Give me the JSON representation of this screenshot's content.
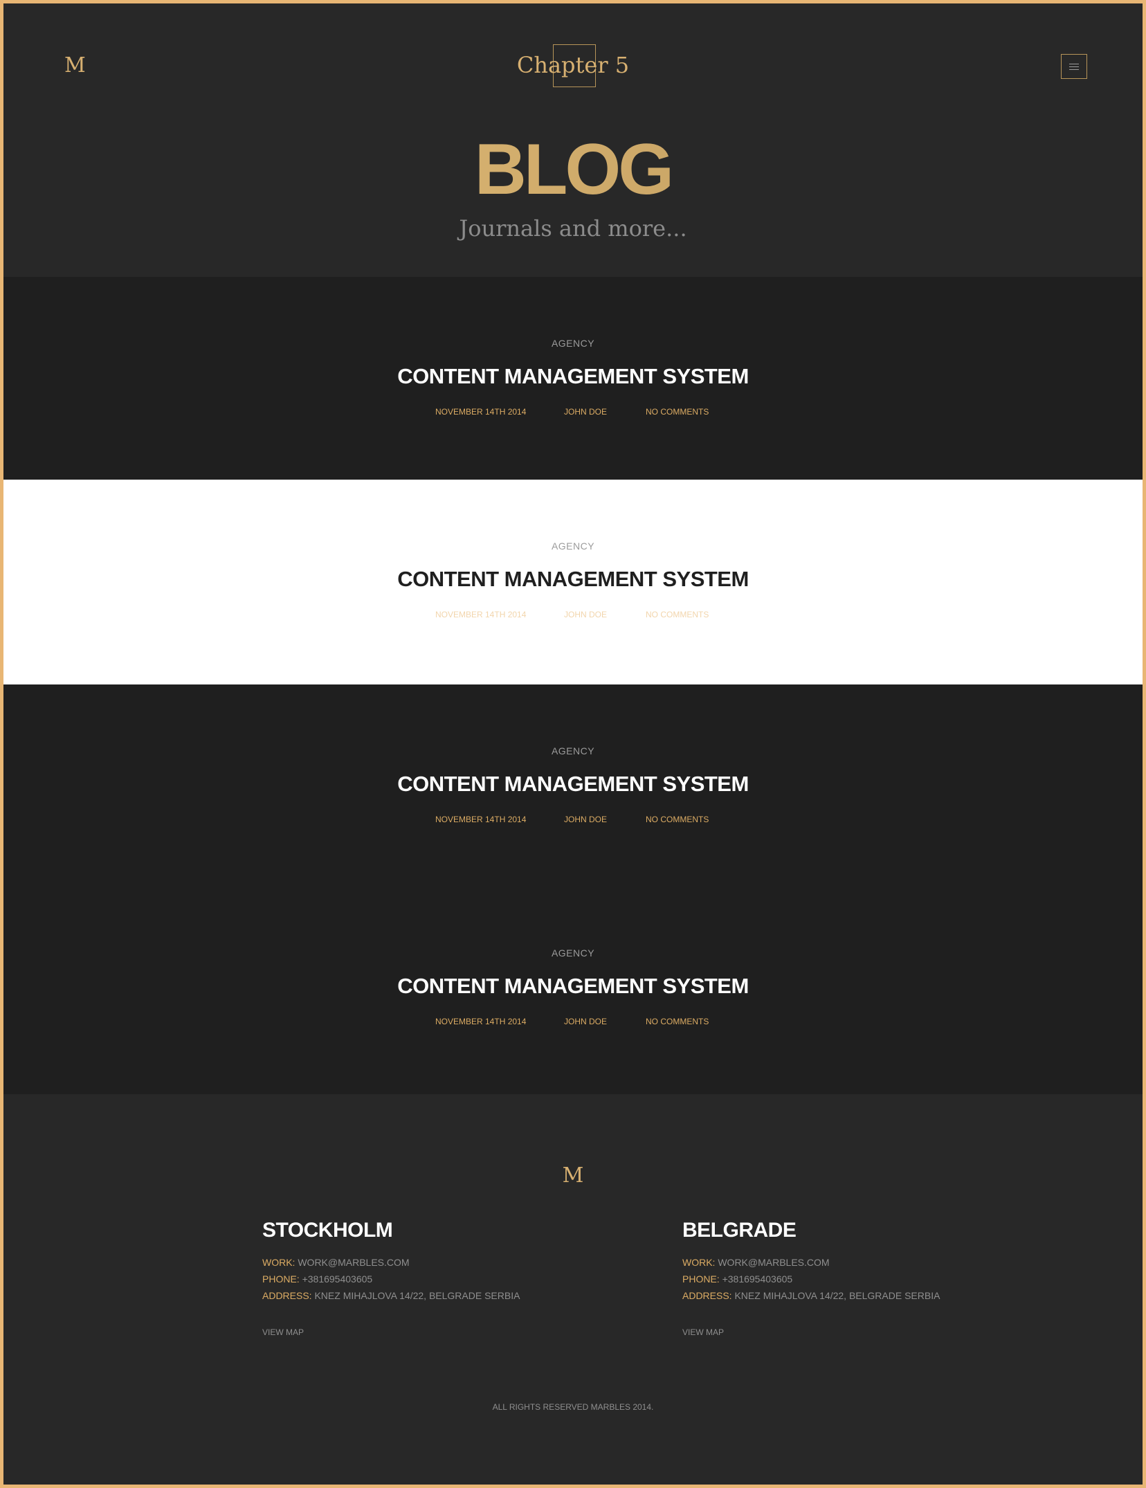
{
  "header": {
    "logo": "M",
    "brand": "Chapter 5",
    "menu_icon": "hamburger-menu-icon",
    "title": "BLOG",
    "subtitle": "Journals and more..."
  },
  "posts": [
    {
      "category": "AGENCY",
      "title": "CONTENT MANAGEMENT SYSTEM",
      "date": "NOVEMBER 14TH 2014",
      "author": "JOHN DOE",
      "comments": "NO COMMENTS"
    },
    {
      "category": "AGENCY",
      "title": "CONTENT MANAGEMENT SYSTEM",
      "date": "NOVEMBER 14TH 2014",
      "author": "JOHN DOE",
      "comments": "NO COMMENTS"
    },
    {
      "category": "AGENCY",
      "title": "CONTENT MANAGEMENT SYSTEM",
      "date": "NOVEMBER 14TH 2014",
      "author": "JOHN DOE",
      "comments": "NO COMMENTS"
    },
    {
      "category": "AGENCY",
      "title": "CONTENT MANAGEMENT SYSTEM",
      "date": "NOVEMBER 14TH 2014",
      "author": "JOHN DOE",
      "comments": "NO COMMENTS"
    }
  ],
  "footer": {
    "logo": "M",
    "offices": [
      {
        "city": "STOCKHOLM",
        "work_label": "WORK:",
        "work": "WORK@MARBLES.COM",
        "phone_label": "PHONE:",
        "phone": "+381695403605",
        "address_label": "ADDRESS:",
        "address": "KNEZ MIHAJLOVA 14/22, BELGRADE SERBIA",
        "view_map": "VIEW MAP"
      },
      {
        "city": "BELGRADE",
        "work_label": "WORK:",
        "work": "WORK@MARBLES.COM",
        "phone_label": "PHONE:",
        "phone": "+381695403605",
        "address_label": "ADDRESS:",
        "address": "KNEZ MIHAJLOVA 14/22, BELGRADE SERBIA",
        "view_map": "VIEW MAP"
      }
    ],
    "copyright": "ALL RIGHTS RESERVED MARBLES 2014."
  },
  "colors": {
    "accent": "#e8b674",
    "gold_text": "#dcac64",
    "dark_bg": "#1f1f1f",
    "header_bg": "#282828"
  }
}
